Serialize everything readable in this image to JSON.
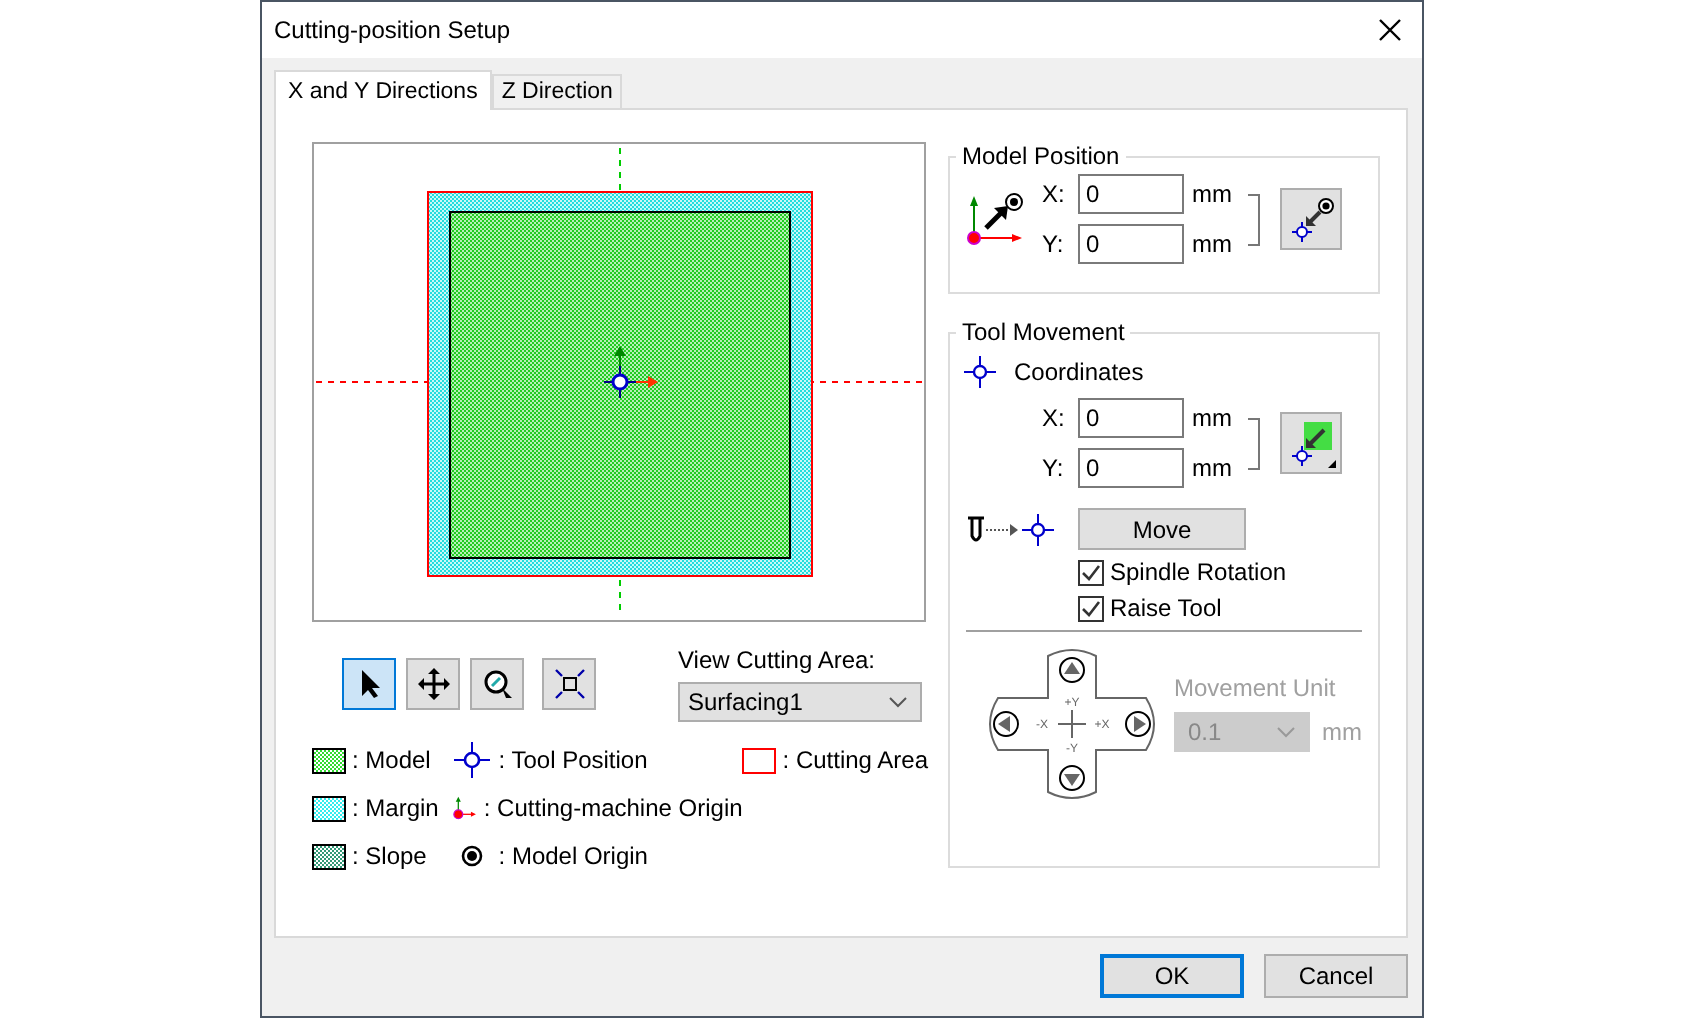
{
  "window": {
    "title": "Cutting-position Setup"
  },
  "tabs": [
    {
      "label": "X and Y Directions",
      "selected": true
    },
    {
      "label": "Z Direction",
      "selected": false
    }
  ],
  "view_tools": [
    {
      "kind": "pointer",
      "selected": true
    },
    {
      "kind": "pan",
      "selected": false
    },
    {
      "kind": "zoom",
      "selected": false
    },
    {
      "kind": "fit",
      "selected": false
    }
  ],
  "view_area": {
    "label": "View Cutting Area:",
    "value": "Surfacing1"
  },
  "legend": [
    {
      "kind": "model",
      "label": ": Model",
      "color": "#33dd33"
    },
    {
      "kind": "margin",
      "label": ": Margin",
      "color": "#33eeee"
    },
    {
      "kind": "slope",
      "label": ": Slope",
      "color": "#339977"
    },
    {
      "kind": "tool",
      "label": ": Tool Position"
    },
    {
      "kind": "machine_origin",
      "label": ": Cutting-machine Origin"
    },
    {
      "kind": "model_origin",
      "label": ": Model Origin"
    },
    {
      "kind": "area",
      "label": ": Cutting Area",
      "color": "#ff0000"
    }
  ],
  "model_position": {
    "title": "Model Position",
    "fields": [
      {
        "label": "X:",
        "value": "0",
        "unit": "mm"
      },
      {
        "label": "Y:",
        "value": "0",
        "unit": "mm"
      }
    ]
  },
  "tool_movement": {
    "title": "Tool Movement",
    "coordinates_label": "Coordinates",
    "fields": [
      {
        "label": "X:",
        "value": "0",
        "unit": "mm"
      },
      {
        "label": "Y:",
        "value": "0",
        "unit": "mm"
      }
    ],
    "move_button": "Move",
    "checkboxes": [
      {
        "label": "Spindle Rotation",
        "checked": true
      },
      {
        "label": "Raise Tool",
        "checked": true
      }
    ],
    "pad_labels": [
      "+Y",
      "-X",
      "+X",
      "-Y"
    ],
    "movement_unit": {
      "label": "Movement Unit",
      "value": "0.1",
      "unit": "mm",
      "disabled": true
    }
  },
  "buttons": [
    {
      "label": "OK",
      "default": true
    },
    {
      "label": "Cancel",
      "default": false
    }
  ]
}
